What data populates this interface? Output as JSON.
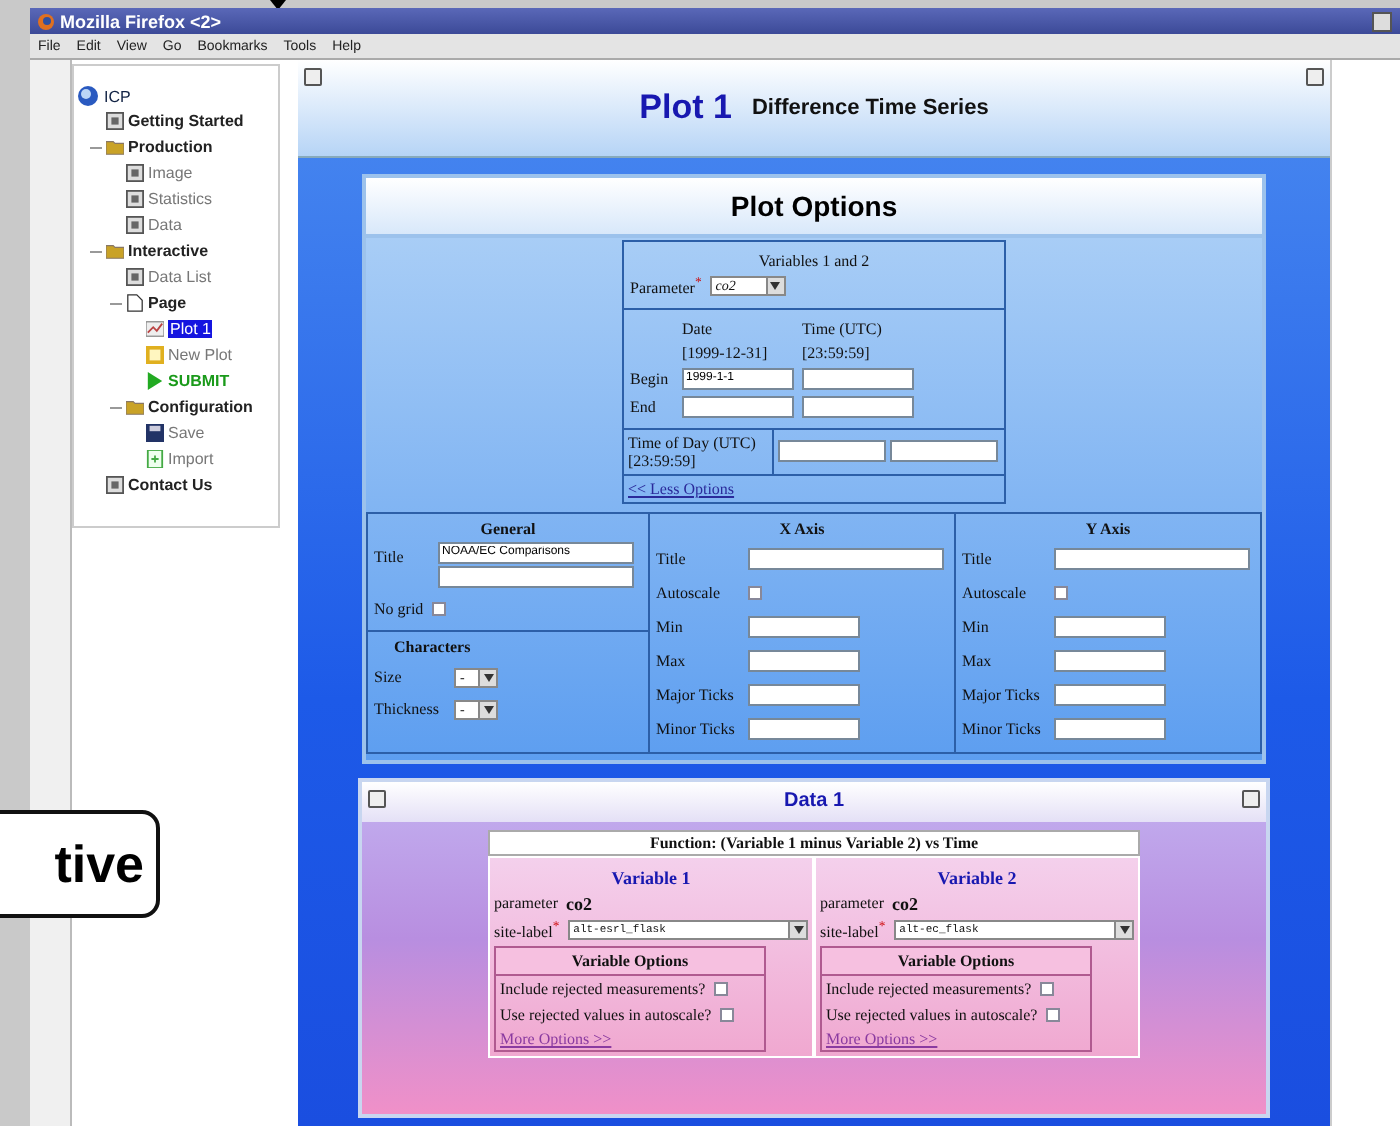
{
  "window": {
    "title": "Mozilla Firefox <2>"
  },
  "menu": [
    "File",
    "Edit",
    "View",
    "Go",
    "Bookmarks",
    "Tools",
    "Help"
  ],
  "sidebar": {
    "root": "ICP",
    "items": [
      {
        "label": "Getting Started",
        "kind": "page",
        "selected": false
      },
      {
        "label": "Production",
        "kind": "folder",
        "selected": false,
        "expanded": true,
        "children": [
          {
            "label": "Image",
            "kind": "page",
            "selected": false
          },
          {
            "label": "Statistics",
            "kind": "page",
            "selected": false
          },
          {
            "label": "Data",
            "kind": "page",
            "selected": false
          }
        ]
      },
      {
        "label": "Interactive",
        "kind": "folder",
        "selected": false,
        "expanded": true,
        "children": [
          {
            "label": "Data List",
            "kind": "page",
            "selected": false
          },
          {
            "label": "Page",
            "kind": "doc",
            "selected": false,
            "expanded": true,
            "children": [
              {
                "label": "Plot 1",
                "kind": "chart",
                "selected": true
              },
              {
                "label": "New Plot",
                "kind": "new",
                "selected": false
              },
              {
                "label": "SUBMIT",
                "kind": "submit",
                "selected": false
              }
            ]
          },
          {
            "label": "Configuration",
            "kind": "folder",
            "selected": false,
            "expanded": true,
            "children": [
              {
                "label": "Save",
                "kind": "save",
                "selected": false
              },
              {
                "label": "Import",
                "kind": "import",
                "selected": false
              }
            ]
          }
        ]
      },
      {
        "label": "Contact Us",
        "kind": "page",
        "selected": false
      }
    ]
  },
  "plot_header": {
    "number": "Plot 1",
    "subtitle": "Difference Time Series"
  },
  "plot_options": {
    "title": "Plot Options",
    "variables": {
      "heading": "Variables 1 and 2",
      "parameter_label": "Parameter",
      "required_mark": "*",
      "parameter_value": "co2"
    },
    "dates": {
      "date_label": "Date",
      "time_label": "Time (UTC)",
      "date_format": "[1999-12-31]",
      "time_format": "[23:59:59]",
      "begin_label": "Begin",
      "begin_date": "1999-1-1",
      "end_label": "End"
    },
    "time_of_day": {
      "label": "Time of Day (UTC)",
      "format": "[23:59:59]"
    },
    "less_link": "<< Less Options",
    "general": {
      "heading": "General",
      "title_label": "Title",
      "title_value": "NOAA/EC Comparisons",
      "no_grid_label": "No grid",
      "no_grid_checked": false
    },
    "characters": {
      "heading": "Characters",
      "size_label": "Size",
      "size_value": "-",
      "thickness_label": "Thickness",
      "thickness_value": "-"
    },
    "axes": [
      {
        "heading": "X Axis",
        "fields": [
          {
            "label": "Title",
            "kind": "wide"
          },
          {
            "label": "Autoscale",
            "kind": "checkbox",
            "checked": false
          },
          {
            "label": "Min",
            "kind": "text"
          },
          {
            "label": "Max",
            "kind": "text"
          },
          {
            "label": "Major Ticks",
            "kind": "text"
          },
          {
            "label": "Minor Ticks",
            "kind": "text"
          }
        ]
      },
      {
        "heading": "Y Axis",
        "fields": [
          {
            "label": "Title",
            "kind": "wide"
          },
          {
            "label": "Autoscale",
            "kind": "checkbox",
            "checked": false
          },
          {
            "label": "Min",
            "kind": "text"
          },
          {
            "label": "Max",
            "kind": "text"
          },
          {
            "label": "Major Ticks",
            "kind": "text"
          },
          {
            "label": "Minor Ticks",
            "kind": "text"
          }
        ]
      }
    ]
  },
  "data": {
    "title": "Data 1",
    "function": "Function: (Variable 1 minus Variable 2) vs Time",
    "variables": [
      {
        "heading": "Variable 1",
        "parameter_label": "parameter",
        "parameter_value": "co2",
        "site_label": "site-label",
        "required_mark": "*",
        "site_value": "alt-esrl_flask",
        "options_heading": "Variable Options",
        "options": [
          {
            "label": "Include rejected measurements?",
            "checked": false
          },
          {
            "label": "Use rejected values in autoscale?",
            "checked": false
          }
        ],
        "more_link": "More Options >>"
      },
      {
        "heading": "Variable 2",
        "parameter_label": "parameter",
        "parameter_value": "co2",
        "site_label": "site-label",
        "required_mark": "*",
        "site_value": "alt-ec_flask",
        "options_heading": "Variable Options",
        "options": [
          {
            "label": "Include rejected measurements?",
            "checked": false
          },
          {
            "label": "Use rejected values in autoscale?",
            "checked": false
          }
        ],
        "more_link": "More Options >>"
      }
    ]
  },
  "callout": {
    "text": "tive"
  }
}
